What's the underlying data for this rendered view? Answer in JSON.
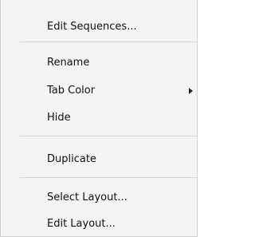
{
  "context_menu": {
    "items": [
      {
        "label": "Edit Sequences..."
      },
      {
        "label": "Rename"
      },
      {
        "label": "Tab Color",
        "submenu_icon": "chevron-right-icon"
      },
      {
        "label": "Hide"
      },
      {
        "label": "Duplicate"
      },
      {
        "label": "Select Layout..."
      },
      {
        "label": "Edit Layout..."
      }
    ]
  },
  "colors": {
    "menu_background": "#f4f4f4",
    "text": "#111111",
    "separator": "#d8d8d8"
  }
}
